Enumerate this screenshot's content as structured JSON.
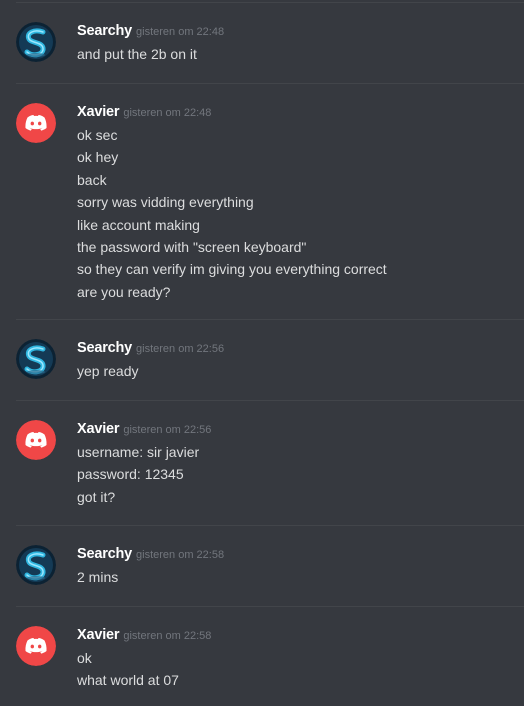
{
  "messages": [
    {
      "author": "Searchy",
      "avatar_icon": "searchy-avatar-icon",
      "timestamp": "gisteren om 22:48",
      "lines": [
        "and put the 2b on it"
      ]
    },
    {
      "author": "Xavier",
      "avatar_icon": "discord-default-avatar-icon",
      "timestamp": "gisteren om 22:48",
      "lines": [
        "ok sec",
        "ok hey",
        "back",
        "sorry was vidding everything",
        "like account making",
        "the password with \"screen keyboard\"",
        "so they can verify im giving you everything correct",
        "are you ready?"
      ]
    },
    {
      "author": "Searchy",
      "avatar_icon": "searchy-avatar-icon",
      "timestamp": "gisteren om 22:56",
      "lines": [
        "yep ready"
      ]
    },
    {
      "author": "Xavier",
      "avatar_icon": "discord-default-avatar-icon",
      "timestamp": "gisteren om 22:56",
      "lines": [
        "username: sir javier",
        "password: 12345",
        "got it?"
      ]
    },
    {
      "author": "Searchy",
      "avatar_icon": "searchy-avatar-icon",
      "timestamp": "gisteren om 22:58",
      "lines": [
        "2 mins"
      ]
    },
    {
      "author": "Xavier",
      "avatar_icon": "discord-default-avatar-icon",
      "timestamp": "gisteren om 22:58",
      "lines": [
        "ok",
        "what world at 07"
      ]
    }
  ],
  "colors": {
    "background": "#36393f",
    "divider": "#42454a",
    "username": "#ffffff",
    "message_text": "#dcddde",
    "timestamp": "#72767d",
    "discord_avatar_red": "#f04747"
  }
}
